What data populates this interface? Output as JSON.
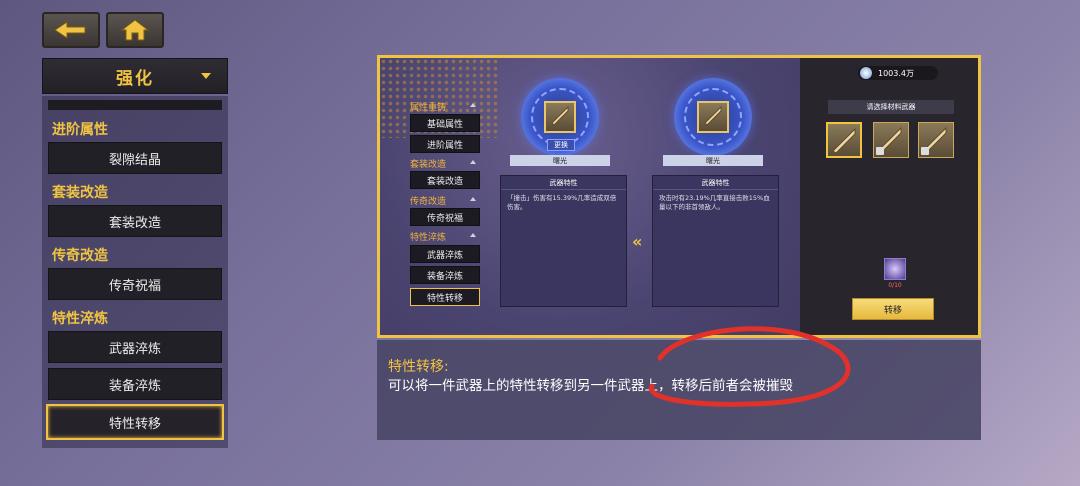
{
  "nav": {
    "back_icon": "back-arrow-icon",
    "home_icon": "home-icon"
  },
  "menu": {
    "title": "强化",
    "categories": [
      {
        "label": "进阶属性",
        "items": [
          "裂隙结晶"
        ]
      },
      {
        "label": "套装改造",
        "items": [
          "套装改造"
        ]
      },
      {
        "label": "传奇改造",
        "items": [
          "传奇祝福"
        ]
      },
      {
        "label": "特性淬炼",
        "items": [
          "武器淬炼",
          "装备淬炼",
          "特性转移"
        ]
      }
    ],
    "active_item": "特性转移"
  },
  "game_screen": {
    "sub_menu": {
      "groups": [
        {
          "label": "属性重铸",
          "items": [
            "基础属性",
            "进阶属性"
          ]
        },
        {
          "label": "套装改造",
          "items": [
            "套装改造"
          ]
        },
        {
          "label": "传奇改造",
          "items": [
            "传奇祝福"
          ]
        },
        {
          "label": "特性淬炼",
          "items": [
            "武器淬炼",
            "装备淬炼",
            "特性转移"
          ]
        }
      ]
    },
    "source_weapon": {
      "name": "曙光",
      "replace_label": "更换",
      "trait_title": "武器特性",
      "trait_text": "「撞击」伤害有15.39%几率造成双倍伤害。"
    },
    "target_weapon": {
      "name": "曙光",
      "trait_title": "武器特性",
      "trait_text": "攻击时有23.19%几率直接击败15%血量以下的非首领敌人。"
    },
    "currency": "1003.4万",
    "material_title": "请选择材料武器",
    "gem_count": "0/10",
    "transfer_button": "转移"
  },
  "description": {
    "title": "特性转移:",
    "text": "可以将一件武器上的特性转移到另一件武器上，转移后前者会被摧毁"
  },
  "colors": {
    "accent": "#f0c442",
    "annotation": "#e0312b"
  }
}
